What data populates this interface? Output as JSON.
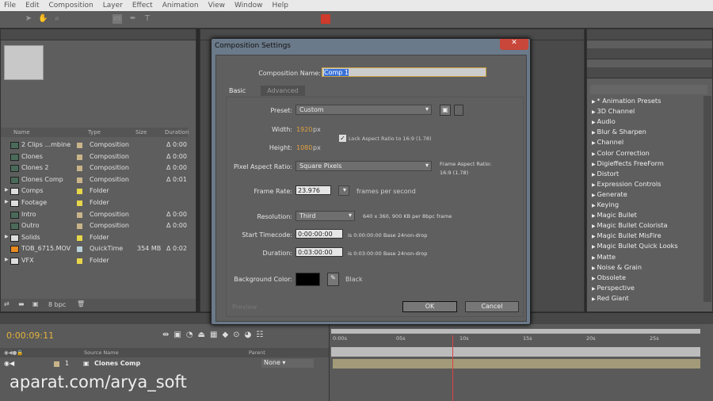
{
  "menu": [
    "File",
    "Edit",
    "Composition",
    "Layer",
    "Effect",
    "Animation",
    "View",
    "Window",
    "Help"
  ],
  "project": {
    "columns": {
      "name": "Name",
      "type": "Type",
      "size": "Size",
      "duration": "Duration"
    },
    "items": [
      {
        "name": "2 Clips ...mbine",
        "type": "Composition",
        "icon": "composition-icon",
        "label": "#c9b48a",
        "size": "",
        "duration": "Δ 0:00"
      },
      {
        "name": "Clones",
        "type": "Composition",
        "icon": "composition-icon",
        "label": "#c9b48a",
        "size": "",
        "duration": "Δ 0:00"
      },
      {
        "name": "Clones 2",
        "type": "Composition",
        "icon": "composition-icon",
        "label": "#c9b48a",
        "size": "",
        "duration": "Δ 0:00"
      },
      {
        "name": "Clones Comp",
        "type": "Composition",
        "icon": "composition-icon",
        "label": "#c9b48a",
        "size": "",
        "duration": "Δ 0:01"
      },
      {
        "name": "Comps",
        "type": "Folder",
        "icon": "folder-icon",
        "label": "#e6d64a",
        "size": "",
        "duration": ""
      },
      {
        "name": "Footage",
        "type": "Folder",
        "icon": "folder-icon",
        "label": "#e6d64a",
        "size": "",
        "duration": ""
      },
      {
        "name": "Intro",
        "type": "Composition",
        "icon": "composition-icon",
        "label": "#c9b48a",
        "size": "",
        "duration": "Δ 0:00"
      },
      {
        "name": "Outro",
        "type": "Composition",
        "icon": "composition-icon",
        "label": "#c9b48a",
        "size": "",
        "duration": "Δ 0:00"
      },
      {
        "name": "Solids",
        "type": "Folder",
        "icon": "folder-icon",
        "label": "#e6d64a",
        "size": "",
        "duration": ""
      },
      {
        "name": "TOB_6715.MOV",
        "type": "QuickTime",
        "icon": "vlc-cone-icon",
        "label": "#b8d0d8",
        "size": "354 MB",
        "duration": "Δ 0:02"
      },
      {
        "name": "VFX",
        "type": "Folder",
        "icon": "folder-icon",
        "label": "#e6d64a",
        "size": "",
        "duration": ""
      }
    ],
    "bpc": "8 bpc"
  },
  "effects": [
    "* Animation Presets",
    "3D Channel",
    "Audio",
    "Blur & Sharpen",
    "Channel",
    "Color Correction",
    "Digieffects FreeForm",
    "Distort",
    "Expression Controls",
    "Generate",
    "Keying",
    "Magic Bullet",
    "Magic Bullet Colorista",
    "Magic Bullet MisFire",
    "Magic Bullet Quick Looks",
    "Matte",
    "Noise & Grain",
    "Obsolete",
    "Perspective",
    "Red Giant"
  ],
  "dialog": {
    "title": "Composition Settings",
    "name_label": "Composition Name:",
    "name_value": "Comp 1",
    "tabs": [
      "Basic",
      "Advanced"
    ],
    "preset_label": "Preset:",
    "preset_value": "Custom",
    "width_label": "Width:",
    "width_value": "1920",
    "height_label": "Height:",
    "height_value": "1080",
    "px": "px",
    "lock_label": "Lock Aspect Ratio to 16:9 (1.78)",
    "lock_checked": true,
    "par_label": "Pixel Aspect Ratio:",
    "par_value": "Square Pixels",
    "far_label": "Frame Aspect Ratio:",
    "far_value": "16:9 (1.78)",
    "fps_label": "Frame Rate:",
    "fps_value": "23.976",
    "fps_unit": "frames per second",
    "res_label": "Resolution:",
    "res_value": "Third",
    "res_info": "640 x 360, 900 KB per 8bpc frame",
    "start_label": "Start Timecode:",
    "start_value": "0:00:00:00",
    "start_info": "is 0:00:00:00  Base 24non-drop",
    "dur_label": "Duration:",
    "dur_value": "0:03:00:00",
    "dur_info": "is 0:03:00:00  Base 24non-drop",
    "bg_label": "Background Color:",
    "bg_color": "#000000",
    "bg_name": "Black",
    "preview": "Preview",
    "ok": "OK",
    "cancel": "Cancel"
  },
  "timeline": {
    "timecode": "0:00:09:11",
    "ruler": [
      "0:00s",
      "05s",
      "10s",
      "15s",
      "20s",
      "25s"
    ],
    "current_time_s": 9.46,
    "cols": {
      "source": "Source Name",
      "parent": "Parent"
    },
    "layer": {
      "num": "1",
      "name": "Clones Comp",
      "parent": "None"
    }
  },
  "watermark": "aparat.com/arya_soft"
}
